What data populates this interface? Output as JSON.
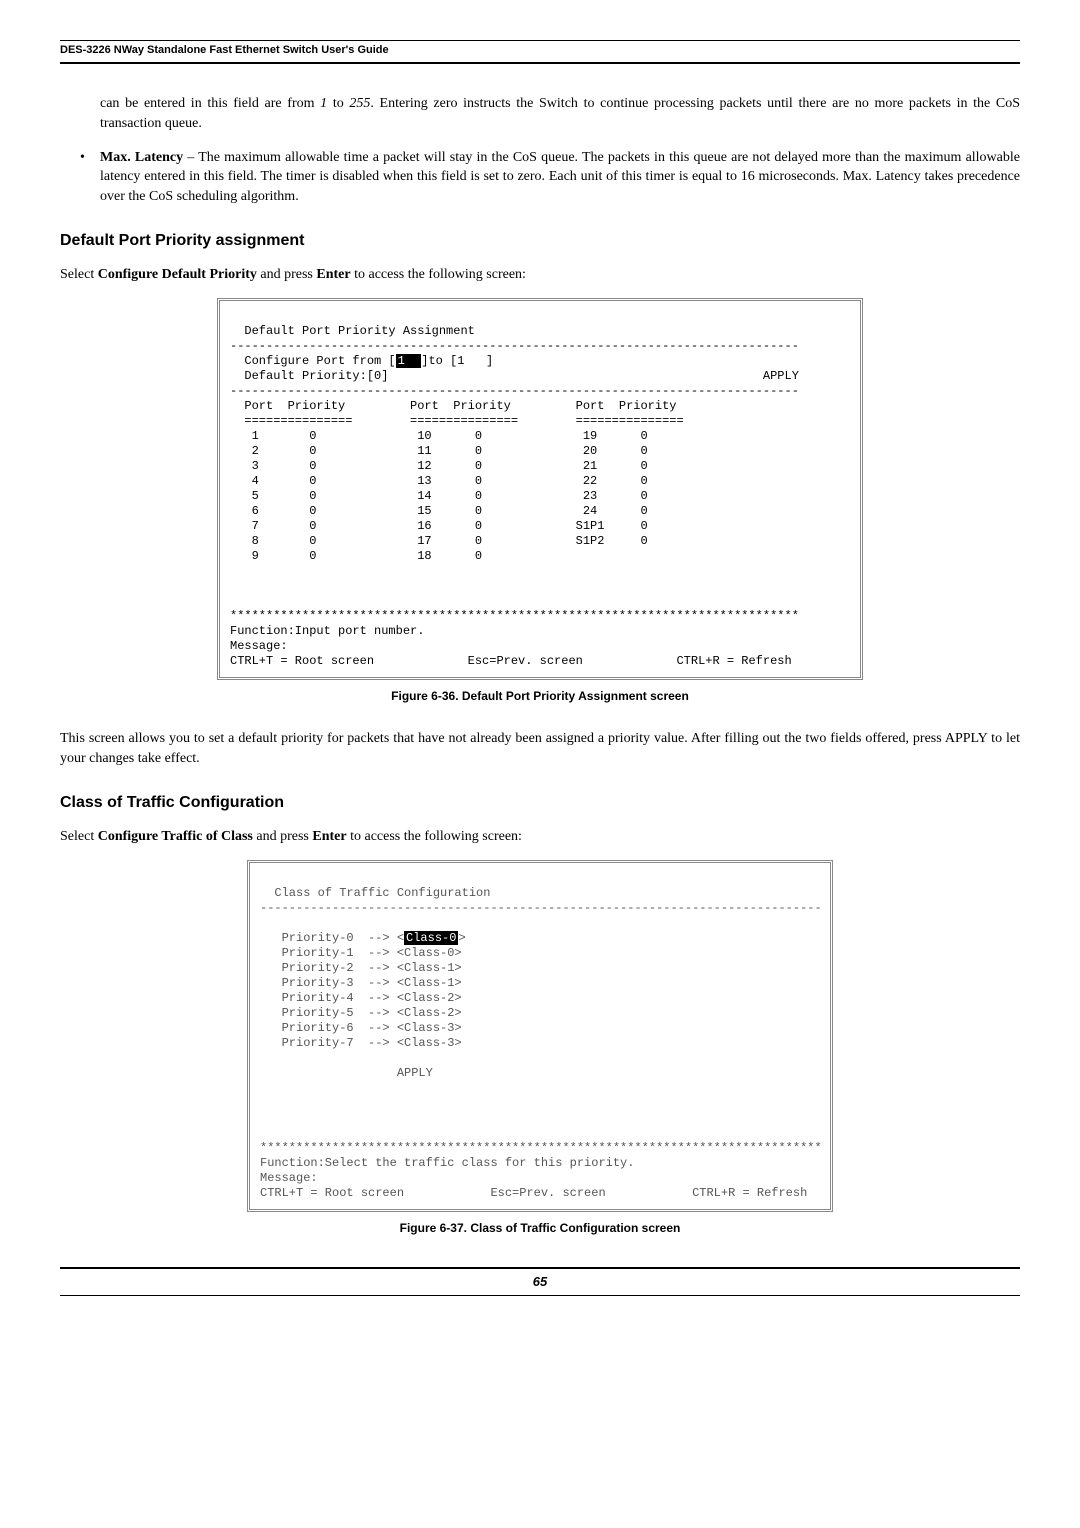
{
  "header": "DES-3226 NWay Standalone Fast Ethernet Switch User's Guide",
  "intro_continued": "can be entered in this field are from ",
  "intro_range_a": "1",
  "intro_mid": " to ",
  "intro_range_b": "255",
  "intro_rest": ". Entering zero instructs the Switch to continue processing packets until there are no more packets in the CoS transaction queue.",
  "bullet_label": "Max. Latency",
  "bullet_text": " – The maximum allowable time a packet will stay in the CoS queue. The packets in this queue are not delayed more than the maximum allowable latency entered in this field. The timer is disabled when this field is set to zero. Each unit of this timer is equal to 16 microseconds. Max. Latency takes precedence over the CoS scheduling algorithm.",
  "section1": "Default Port Priority assignment",
  "para1_a": "Select ",
  "para1_b": "Configure Default Priority",
  "para1_c": " and press ",
  "para1_d": "Enter",
  "para1_e": " to access the following screen:",
  "terminal1": {
    "title": "  Default Port Priority Assignment",
    "rule": "-------------------------------------------------------------------------------",
    "cfg1_a": "  Configure Port from [",
    "cfg1_hl": "1  ",
    "cfg1_b": "]to [1   ]",
    "cfg2": "  Default Priority:[0]                                                    APPLY",
    "hdr": "  Port  Priority         Port  Priority         Port  Priority",
    "hdrline": "  ===============        ===============        ===============",
    "rows": [
      "   1       0              10      0              19      0",
      "   2       0              11      0              20      0",
      "   3       0              12      0              21      0",
      "   4       0              13      0              22      0",
      "   5       0              14      0              23      0",
      "   6       0              15      0              24      0",
      "   7       0              16      0             S1P1     0",
      "   8       0              17      0             S1P2     0",
      "   9       0              18      0"
    ],
    "stars": "*******************************************************************************",
    "func": "Function:Input port number.",
    "msg": "Message:",
    "foot": "CTRL+T = Root screen             Esc=Prev. screen             CTRL+R = Refresh"
  },
  "caption1": "Figure 6-36.  Default Port Priority Assignment screen",
  "para2": "This screen allows you to set a default priority for packets that have not already been assigned a priority value. After filling out the two fields offered, press APPLY to let your changes take effect.",
  "section2": "Class of Traffic Configuration",
  "para3_a": "Select ",
  "para3_b": "Configure Traffic of Class",
  "para3_c": " and press ",
  "para3_d": "Enter",
  "para3_e": " to access the following screen:",
  "terminal2": {
    "title": "  Class of Traffic Configuration",
    "rule": "------------------------------------------------------------------------------",
    "p0a": "   Priority-0  --> <",
    "p0hl": "Class-0",
    "p0b": ">",
    "lines": [
      "   Priority-1  --> <Class-0>",
      "   Priority-2  --> <Class-1>",
      "   Priority-3  --> <Class-1>",
      "   Priority-4  --> <Class-2>",
      "   Priority-5  --> <Class-2>",
      "   Priority-6  --> <Class-3>",
      "   Priority-7  --> <Class-3>"
    ],
    "apply": "                   APPLY",
    "stars": "******************************************************************************",
    "func": "Function:Select the traffic class for this priority.",
    "msg": "Message:",
    "foot": "CTRL+T = Root screen            Esc=Prev. screen            CTRL+R = Refresh"
  },
  "caption2": "Figure 6-37.  Class of Traffic Configuration screen",
  "page_num": "65"
}
